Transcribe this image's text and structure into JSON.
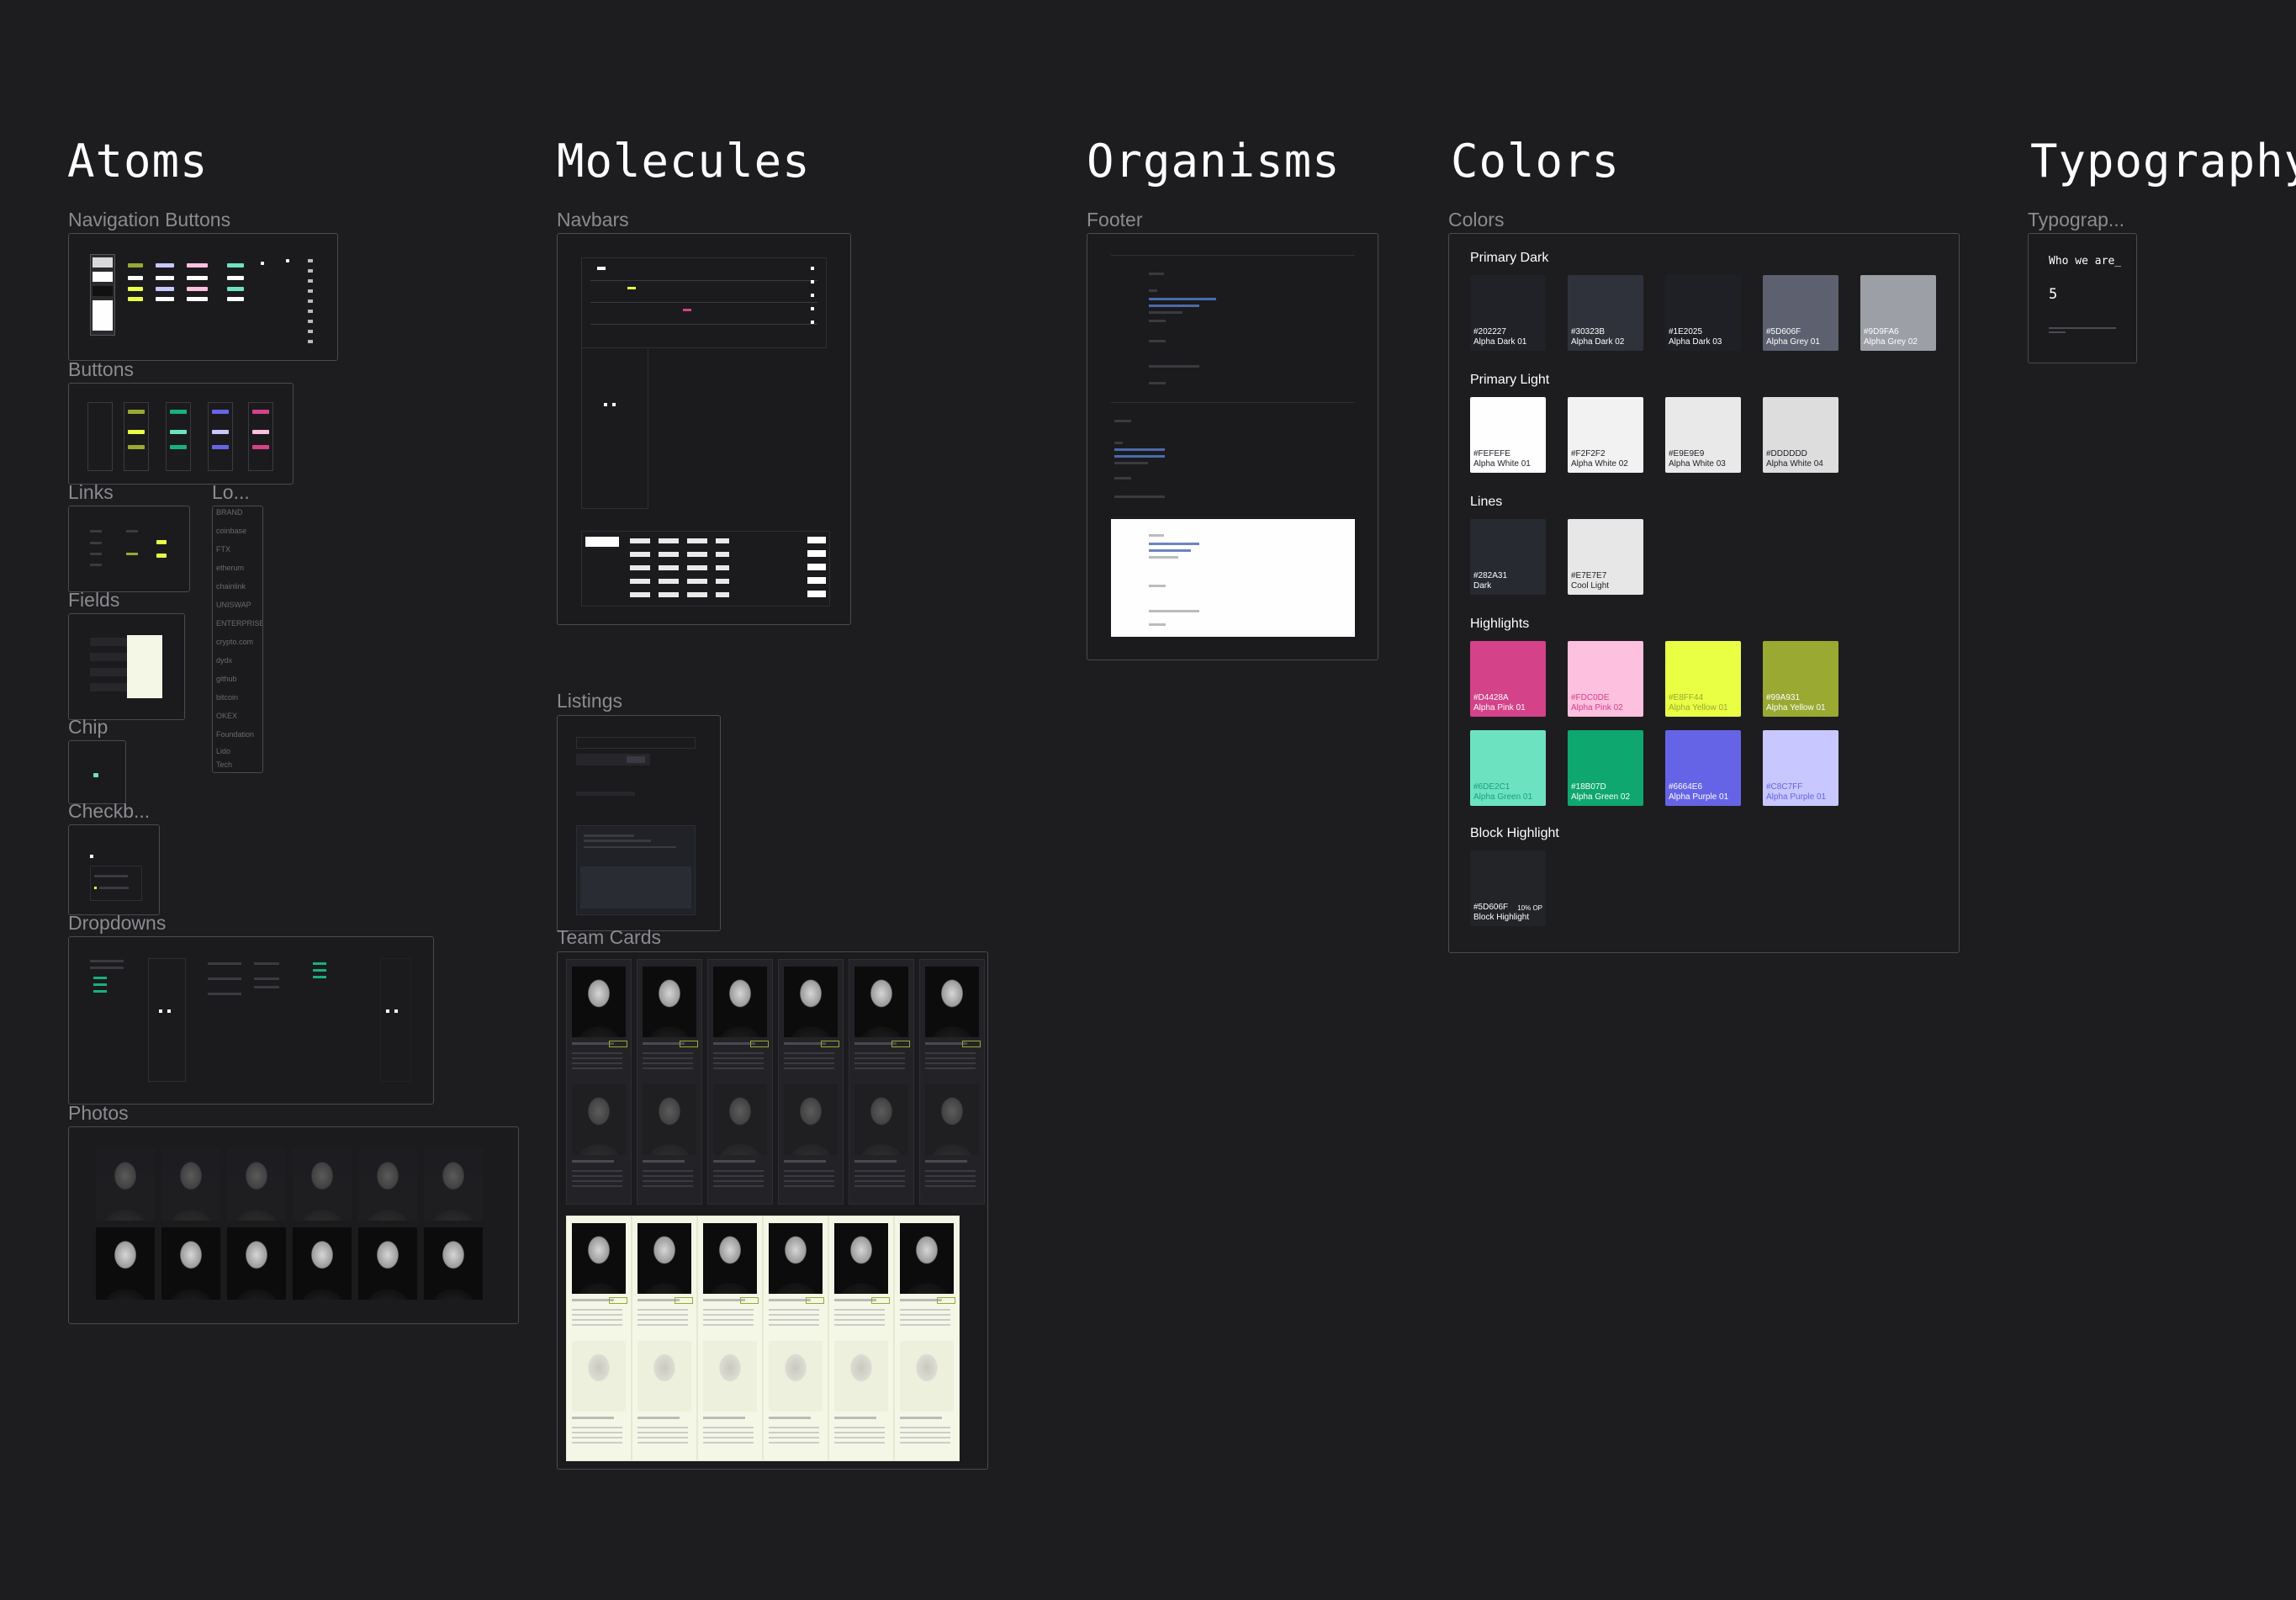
{
  "sections": {
    "atoms": "Atoms",
    "molecules": "Molecules",
    "organisms": "Organisms",
    "colors": "Colors",
    "typography": "Typography"
  },
  "atoms": {
    "navigation_buttons": "Navigation Buttons",
    "buttons": "Buttons",
    "links": "Links",
    "logos": "Lo...",
    "fields": "Fields",
    "chip": "Chip",
    "checkboxes": "Checkb...",
    "dropdowns": "Dropdowns",
    "photos": "Photos"
  },
  "logos": [
    "BRAND",
    "coinbase",
    "FTX",
    "etherum",
    "chainlink",
    "UNISWAP",
    "ENTERPRISE",
    "crypto.com",
    "dydx",
    "github",
    "bitcoin",
    "OKEX",
    "Foundation",
    "Lido",
    "Tech"
  ],
  "molecules": {
    "navbars": "Navbars",
    "listings": "Listings",
    "team_cards": "Team Cards"
  },
  "organisms": {
    "footer": "Footer"
  },
  "colors": {
    "frame_label": "Colors",
    "groups": {
      "primary_dark": "Primary Dark",
      "primary_light": "Primary Light",
      "lines": "Lines",
      "highlights": "Highlights",
      "block_highlight": "Block Highlight"
    },
    "primary_dark": [
      {
        "hex": "#202227",
        "name": "Alpha Dark 01",
        "color": "#202227",
        "text": "#fefefe"
      },
      {
        "hex": "#30323B",
        "name": "Alpha Dark 02",
        "color": "#30323b",
        "text": "#fefefe"
      },
      {
        "hex": "#1E2025",
        "name": "Alpha Dark 03",
        "color": "#1e2025",
        "text": "#fefefe"
      },
      {
        "hex": "#5D606F",
        "name": "Alpha Grey 01",
        "color": "#5d606f",
        "text": "#fefefe"
      },
      {
        "hex": "#9D9FA6",
        "name": "Alpha Grey 02",
        "color": "#9d9fa6",
        "text": "#fefefe"
      }
    ],
    "primary_light": [
      {
        "hex": "#FEFEFE",
        "name": "Alpha White 01",
        "color": "#fefefe",
        "text": "#202227"
      },
      {
        "hex": "#F2F2F2",
        "name": "Alpha White 02",
        "color": "#f2f2f2",
        "text": "#202227"
      },
      {
        "hex": "#E9E9E9",
        "name": "Alpha White 03",
        "color": "#e9e9e9",
        "text": "#202227"
      },
      {
        "hex": "#DDDDDD",
        "name": "Alpha White 04",
        "color": "#dddddd",
        "text": "#202227"
      }
    ],
    "lines": [
      {
        "hex": "#282A31",
        "name": "Dark",
        "color": "#282a31",
        "text": "#fefefe"
      },
      {
        "hex": "#E7E7E7",
        "name": "Cool Light",
        "color": "#e7e7e7",
        "text": "#202227"
      }
    ],
    "highlights": [
      {
        "hex": "#D4428A",
        "name": "Alpha Pink 01",
        "color": "#d4428a",
        "text": "#fefefe"
      },
      {
        "hex": "#FDC0DE",
        "name": "Alpha Pink 02",
        "color": "#fdc0de",
        "text": "#d4428a"
      },
      {
        "hex": "#E8FF44",
        "name": "Alpha Yellow 01",
        "color": "#e8ff44",
        "text": "#99a931"
      },
      {
        "hex": "#99A931",
        "name": "Alpha Yellow 01",
        "color": "#99a931",
        "text": "#fefefe"
      },
      {
        "hex": "#6DE2C1",
        "name": "Alpha Green 01",
        "color": "#6de2c1",
        "text": "#18a07d"
      },
      {
        "hex": "#18B07D",
        "name": "Alpha Green 02",
        "color": "#0ea76f",
        "text": "#fefefe"
      },
      {
        "hex": "#6664E6",
        "name": "Alpha Purple 01",
        "color": "#6664e6",
        "text": "#fefefe"
      },
      {
        "hex": "#C8C7FF",
        "name": "Alpha Purple 01",
        "color": "#c8c7ff",
        "text": "#6664e6"
      }
    ],
    "block_highlight": [
      {
        "hex": "#5D606F",
        "pct": "10% OP",
        "name": "Block Highlight",
        "color": "#232428",
        "text": "#fefefe"
      }
    ]
  },
  "typography": {
    "frame_label": "Typograp...",
    "sample_heading": "Who we are_",
    "sample_number": "5"
  },
  "footer_code": [
    "{",
    "  \"name\": \"alpha\",",
    "  \"lang\": \"en\",",
    "}",
    "Alpha - Foundation"
  ]
}
